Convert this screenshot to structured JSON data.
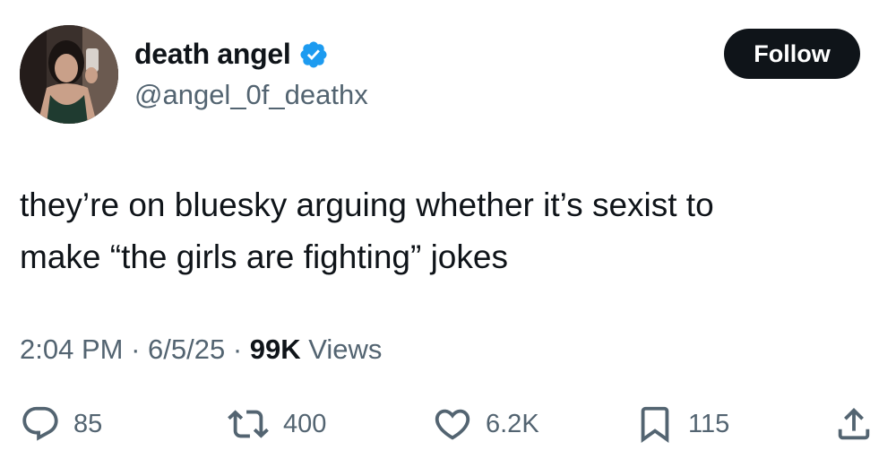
{
  "author": {
    "display_name": "death angel",
    "handle": "@angel_0f_deathx",
    "avatar_icon": "profile-photo",
    "verified_icon": "verified-badge-icon",
    "verified_color": "#1d9bf0"
  },
  "follow_button": {
    "label": "Follow",
    "bg_color": "#0f1419"
  },
  "tweet": {
    "line1": "they’re on bluesky arguing whether it’s sexist to",
    "line2": "make “the girls are fighting” jokes"
  },
  "meta": {
    "time": "2:04 PM",
    "sep1": " · ",
    "date": "6/5/25",
    "sep2": " · ",
    "views_count": "99K",
    "views_label": " Views"
  },
  "actions": {
    "replies": "85",
    "retweets": "400",
    "likes": "6.2K",
    "bookmarks": "115",
    "icons": [
      "reply-icon",
      "retweet-icon",
      "like-icon",
      "bookmark-icon",
      "share-icon"
    ]
  },
  "colors": {
    "text": "#0f1419",
    "secondary": "#536471",
    "background": "#ffffff"
  }
}
